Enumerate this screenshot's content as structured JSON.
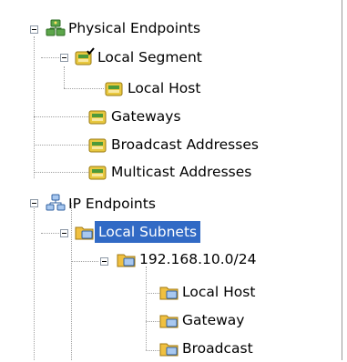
{
  "tree": {
    "nodes": [
      {
        "label": "Physical Endpoints",
        "icon": "network-group-icon"
      },
      {
        "label": "Local Segment",
        "icon": "segment-check-icon"
      },
      {
        "label": "Local Host",
        "icon": "segment-icon"
      },
      {
        "label": "Gateways",
        "icon": "segment-icon"
      },
      {
        "label": "Broadcast Addresses",
        "icon": "segment-icon"
      },
      {
        "label": "Multicast Addresses",
        "icon": "segment-icon"
      },
      {
        "label": "IP Endpoints",
        "icon": "ip-network-icon"
      },
      {
        "label": "Local Subnets",
        "icon": "ip-folder-icon",
        "selected": true
      },
      {
        "label": "192.168.10.0/24",
        "icon": "ip-folder-icon"
      },
      {
        "label": "Local Host",
        "icon": "ip-folder-icon"
      },
      {
        "label": "Gateway",
        "icon": "ip-folder-icon"
      },
      {
        "label": "Broadcast",
        "icon": "ip-folder-icon"
      }
    ]
  },
  "colors": {
    "selection": "#316ac5",
    "tree_lines": "#a0a0a0",
    "segment_icon": "#e8c840",
    "ip_icon": "#f0c040"
  }
}
